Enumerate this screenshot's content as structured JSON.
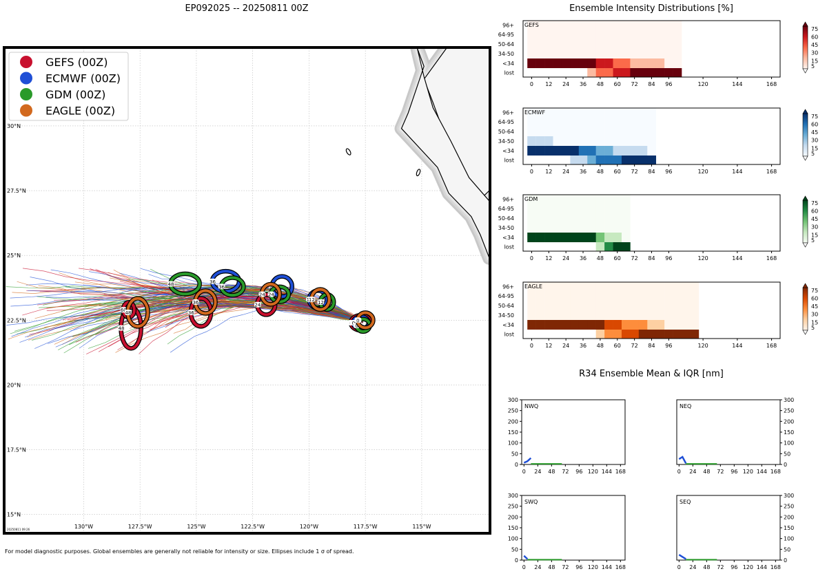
{
  "figure_title": "EP092025 -- 20250811 00Z",
  "intensity_title": "Ensemble Intensity Distributions [%]",
  "r34_title": "R34 Ensemble Mean & IQR [nm]",
  "footnote": "For model diagnostic purposes. Global ensembles are generally not reliable for intensity or size. Ellipses include 1 σ of spread.",
  "map_stamp": "20250811 09:26",
  "colors": {
    "gefs": "#c8102e",
    "ecmwf": "#1f4fd6",
    "gdm": "#2a9a2a",
    "eagle": "#d2691e",
    "land": "#f2f2f2",
    "coast": "#000000"
  },
  "chart_data": [
    {
      "type": "scatter",
      "name": "track-map",
      "xlim": [
        -133.5,
        -112.0
      ],
      "ylim": [
        14.3,
        33.0
      ],
      "x_ticks": [
        -130,
        -127.5,
        -125,
        -122.5,
        -120,
        -117.5,
        -115
      ],
      "x_tick_labels": [
        "130°W",
        "127.5°W",
        "125°W",
        "122.5°W",
        "120°W",
        "117.5°W",
        "115°W"
      ],
      "y_ticks": [
        15,
        17.5,
        20,
        22.5,
        25,
        27.5,
        30
      ],
      "y_tick_labels": [
        "15°N",
        "17.5°N",
        "20°N",
        "22.5°N",
        "25°N",
        "27.5°N",
        "30°N"
      ],
      "legend": {
        "placement": "top-left",
        "entries": [
          "GEFS (00Z)",
          "ECMWF (00Z)",
          "GDM (00Z)",
          "EAGLE (00Z)"
        ]
      },
      "series": [
        {
          "name": "GEFS (00Z)",
          "color": "#c8102e",
          "ellipses": [
            {
              "label": "0",
              "lon": -117.7,
              "lat": 22.4,
              "rx": 0.4,
              "ry": 0.25
            },
            {
              "label": "24",
              "lon": -121.9,
              "lat": 23.1,
              "rx": 0.35,
              "ry": 0.35
            },
            {
              "label": "36",
              "lon": -124.8,
              "lat": 22.8,
              "rx": 0.4,
              "ry": 0.5
            },
            {
              "label": "48",
              "lon": -127.9,
              "lat": 22.2,
              "rx": 0.4,
              "ry": 0.75
            },
            {
              "label": "60",
              "lon": -128.0,
              "lat": 22.9,
              "rx": 0.2,
              "ry": 0.25
            }
          ]
        },
        {
          "name": "ECMWF (00Z)",
          "color": "#1f4fd6",
          "ellipses": [
            {
              "label": "0",
              "lon": -117.7,
              "lat": 22.4,
              "rx": 0.3,
              "ry": 0.2
            },
            {
              "label": "12",
              "lon": -119.6,
              "lat": 23.3,
              "rx": 0.35,
              "ry": 0.3
            },
            {
              "label": "24",
              "lon": -121.2,
              "lat": 23.8,
              "rx": 0.4,
              "ry": 0.35
            },
            {
              "label": "36",
              "lon": -123.7,
              "lat": 24.0,
              "rx": 0.55,
              "ry": 0.35
            }
          ]
        },
        {
          "name": "GDM (00Z)",
          "color": "#2a9a2a",
          "ellipses": [
            {
              "label": "0",
              "lon": -117.6,
              "lat": 22.3,
              "rx": 0.25,
              "ry": 0.2
            },
            {
              "label": "12",
              "lon": -119.2,
              "lat": 23.2,
              "rx": 0.25,
              "ry": 0.25
            },
            {
              "label": "24",
              "lon": -121.3,
              "lat": 23.5,
              "rx": 0.35,
              "ry": 0.25
            },
            {
              "label": "36",
              "lon": -123.4,
              "lat": 23.8,
              "rx": 0.45,
              "ry": 0.3
            },
            {
              "label": "48",
              "lon": -125.5,
              "lat": 23.9,
              "rx": 0.6,
              "ry": 0.35
            }
          ]
        },
        {
          "name": "EAGLE (00Z)",
          "color": "#d2691e",
          "ellipses": [
            {
              "label": "0",
              "lon": -117.5,
              "lat": 22.5,
              "rx": 0.3,
              "ry": 0.25
            },
            {
              "label": "12",
              "lon": -119.5,
              "lat": 23.3,
              "rx": 0.35,
              "ry": 0.35
            },
            {
              "label": "24",
              "lon": -121.7,
              "lat": 23.5,
              "rx": 0.35,
              "ry": 0.35
            },
            {
              "label": "36",
              "lon": -124.6,
              "lat": 23.2,
              "rx": 0.4,
              "ry": 0.4
            },
            {
              "label": "48",
              "lon": -127.6,
              "lat": 22.8,
              "rx": 0.4,
              "ry": 0.5
            }
          ]
        }
      ]
    },
    {
      "type": "heatmap",
      "name": "intensity-distributions",
      "x_ticks": [
        0,
        12,
        24,
        36,
        48,
        60,
        72,
        84,
        96,
        120,
        144,
        168
      ],
      "xlim": [
        -6,
        174
      ],
      "y_categories": [
        "lost",
        "<34",
        "34-50",
        "50-64",
        "64-95",
        "96+"
      ],
      "colorbar_ticks": [
        5,
        15,
        30,
        45,
        60,
        75
      ],
      "panels": [
        {
          "name": "GEFS",
          "colors": [
            "#fff5f0",
            "#fcbba1",
            "#fb6a4a",
            "#cb181d",
            "#67000d"
          ],
          "columns": [
            {
              "t": 0,
              "lost": 0,
              "ts": 100
            },
            {
              "t": 6,
              "lost": 0,
              "ts": 100
            },
            {
              "t": 12,
              "lost": 0,
              "ts": 100
            },
            {
              "t": 18,
              "lost": 0,
              "ts": 100
            },
            {
              "t": 24,
              "lost": 0,
              "ts": 100
            },
            {
              "t": 30,
              "lost": 0,
              "ts": 100
            },
            {
              "t": 36,
              "lost": 0,
              "ts": 100
            },
            {
              "t": 42,
              "lost": 15,
              "ts": 85
            },
            {
              "t": 48,
              "lost": 30,
              "ts": 70
            },
            {
              "t": 54,
              "lost": 45,
              "ts": 55
            },
            {
              "t": 60,
              "lost": 55,
              "ts": 45
            },
            {
              "t": 66,
              "lost": 70,
              "ts": 30
            },
            {
              "t": 72,
              "lost": 85,
              "ts": 15
            },
            {
              "t": 78,
              "lost": 90,
              "ts": 10
            },
            {
              "t": 84,
              "lost": 90,
              "ts": 10
            },
            {
              "t": 90,
              "lost": 90,
              "ts": 10
            },
            {
              "t": 96,
              "lost": 100,
              "ts": 0
            },
            {
              "t": 102,
              "lost": 100,
              "ts": 0
            }
          ]
        },
        {
          "name": "ECMWF",
          "colors": [
            "#f7fbff",
            "#c6dbef",
            "#6baed6",
            "#2171b5",
            "#08306b"
          ],
          "columns": [
            {
              "t": 0,
              "lost": 0,
              "ts": 100,
              "b34": 20
            },
            {
              "t": 6,
              "lost": 0,
              "ts": 100,
              "b34": 20
            },
            {
              "t": 12,
              "lost": 0,
              "ts": 100,
              "b34": 15
            },
            {
              "t": 18,
              "lost": 0,
              "ts": 100
            },
            {
              "t": 24,
              "lost": 0,
              "ts": 95
            },
            {
              "t": 30,
              "lost": 10,
              "ts": 90
            },
            {
              "t": 36,
              "lost": 25,
              "ts": 75
            },
            {
              "t": 42,
              "lost": 45,
              "ts": 55
            },
            {
              "t": 48,
              "lost": 60,
              "ts": 40
            },
            {
              "t": 54,
              "lost": 70,
              "ts": 30
            },
            {
              "t": 60,
              "lost": 75,
              "ts": 25
            },
            {
              "t": 66,
              "lost": 80,
              "ts": 20
            },
            {
              "t": 72,
              "lost": 85,
              "ts": 15
            },
            {
              "t": 78,
              "lost": 90,
              "ts": 10
            },
            {
              "t": 84,
              "lost": 100,
              "ts": 0
            }
          ]
        },
        {
          "name": "GDM",
          "colors": [
            "#f7fcf5",
            "#c7e9c0",
            "#74c476",
            "#238b45",
            "#00441b"
          ],
          "columns": [
            {
              "t": 0,
              "lost": 0,
              "ts": 100
            },
            {
              "t": 6,
              "lost": 0,
              "ts": 100
            },
            {
              "t": 12,
              "lost": 0,
              "ts": 100
            },
            {
              "t": 18,
              "lost": 0,
              "ts": 100
            },
            {
              "t": 24,
              "lost": 0,
              "ts": 100
            },
            {
              "t": 30,
              "lost": 0,
              "ts": 100
            },
            {
              "t": 36,
              "lost": 0,
              "ts": 100
            },
            {
              "t": 42,
              "lost": 0,
              "ts": 100
            },
            {
              "t": 48,
              "lost": 10,
              "ts": 50
            },
            {
              "t": 54,
              "lost": 60,
              "ts": 25
            },
            {
              "t": 60,
              "lost": 100,
              "ts": 15
            },
            {
              "t": 66,
              "lost": 100,
              "ts": 0
            }
          ]
        },
        {
          "name": "EAGLE",
          "colors": [
            "#fff5eb",
            "#fdd0a2",
            "#fd8d3c",
            "#d94801",
            "#7f2704"
          ],
          "columns": [
            {
              "t": 0,
              "lost": 0,
              "ts": 100
            },
            {
              "t": 6,
              "lost": 0,
              "ts": 100
            },
            {
              "t": 12,
              "lost": 0,
              "ts": 100
            },
            {
              "t": 18,
              "lost": 0,
              "ts": 100
            },
            {
              "t": 24,
              "lost": 0,
              "ts": 100
            },
            {
              "t": 30,
              "lost": 0,
              "ts": 100
            },
            {
              "t": 36,
              "lost": 0,
              "ts": 100
            },
            {
              "t": 42,
              "lost": 0,
              "ts": 100
            },
            {
              "t": 48,
              "lost": 15,
              "ts": 85
            },
            {
              "t": 54,
              "lost": 30,
              "ts": 70
            },
            {
              "t": 60,
              "lost": 45,
              "ts": 55
            },
            {
              "t": 66,
              "lost": 55,
              "ts": 45
            },
            {
              "t": 72,
              "lost": 70,
              "ts": 30
            },
            {
              "t": 78,
              "lost": 80,
              "ts": 30
            },
            {
              "t": 84,
              "lost": 85,
              "ts": 20
            },
            {
              "t": 90,
              "lost": 90,
              "ts": 15
            },
            {
              "t": 96,
              "lost": 95,
              "ts": 0
            },
            {
              "t": 102,
              "lost": 95,
              "ts": 0
            },
            {
              "t": 108,
              "lost": 95,
              "ts": 0
            },
            {
              "t": 114,
              "lost": 100,
              "ts": 0
            }
          ]
        }
      ]
    },
    {
      "type": "line",
      "name": "r34-mean-iqr",
      "x_ticks": [
        0,
        24,
        48,
        72,
        96,
        120,
        144,
        168
      ],
      "xlim": [
        -4,
        176
      ],
      "y_ticks": [
        0,
        50,
        100,
        150,
        200,
        250,
        300
      ],
      "ylim": [
        0,
        300
      ],
      "panels": [
        {
          "name": "NWQ",
          "series": [
            {
              "model": "ECMWF",
              "color": "#1f4fd6",
              "x": [
                0,
                6,
                12
              ],
              "y": [
                8,
                15,
                30
              ]
            },
            {
              "model": "GDM",
              "color": "#2a9a2a",
              "x": [
                12,
                24,
                36,
                48,
                60,
                66
              ],
              "y": [
                3,
                3,
                3,
                3,
                3,
                3
              ]
            }
          ]
        },
        {
          "name": "NEQ",
          "series": [
            {
              "model": "ECMWF",
              "color": "#1f4fd6",
              "x": [
                0,
                6,
                12
              ],
              "y": [
                25,
                35,
                5
              ]
            },
            {
              "model": "GDM",
              "color": "#2a9a2a",
              "x": [
                12,
                24,
                36,
                48,
                60,
                66
              ],
              "y": [
                3,
                3,
                3,
                3,
                3,
                3
              ]
            }
          ]
        },
        {
          "name": "SWQ",
          "series": [
            {
              "model": "ECMWF",
              "color": "#1f4fd6",
              "x": [
                0,
                6
              ],
              "y": [
                20,
                5
              ]
            },
            {
              "model": "GDM",
              "color": "#2a9a2a",
              "x": [
                6,
                24,
                48,
                66
              ],
              "y": [
                2,
                2,
                2,
                2
              ]
            }
          ]
        },
        {
          "name": "SEQ",
          "series": [
            {
              "model": "ECMWF",
              "color": "#1f4fd6",
              "x": [
                0,
                6,
                12
              ],
              "y": [
                25,
                15,
                5
              ]
            },
            {
              "model": "GDM",
              "color": "#2a9a2a",
              "x": [
                12,
                24,
                48,
                66
              ],
              "y": [
                2,
                2,
                2,
                2
              ]
            }
          ]
        }
      ]
    }
  ]
}
